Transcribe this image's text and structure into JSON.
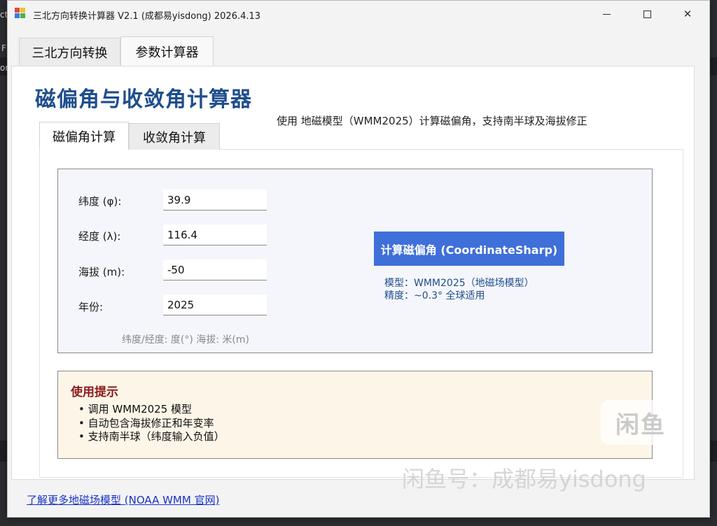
{
  "window": {
    "title": "三北方向转换计算器 V2.1 (成都易yisdong) 2026.4.13"
  },
  "outer_tabs": [
    {
      "label": "三北方向转换",
      "active": false
    },
    {
      "label": "参数计算器",
      "active": true
    }
  ],
  "page": {
    "title": "磁偏角与收敛角计算器",
    "subtitle": "使用 地磁模型（WMM2025）计算磁偏角，支持南半球及海拔修正"
  },
  "inner_tabs": [
    {
      "label": "磁偏角计算",
      "active": true
    },
    {
      "label": "收敛角计算",
      "active": false
    }
  ],
  "form": {
    "latitude": {
      "label": "纬度 (φ):",
      "value": "39.9"
    },
    "longitude": {
      "label": "经度 (λ):",
      "value": "116.4"
    },
    "altitude": {
      "label": "海拔 (m):",
      "value": "-50"
    },
    "year": {
      "label": "年份:",
      "value": "2025"
    },
    "unit_note": "纬度/经度: 度(°)  海拔: 米(m)"
  },
  "action": {
    "calc_label": "计算磁偏角 (CoordinateSharp)",
    "model_line": "模型：WMM2025（地磁场模型）",
    "accuracy_line": "精度：~0.3° 全球适用"
  },
  "tips": {
    "title": "使用提示",
    "items": [
      "• 调用 WMM2025 模型",
      "• 自动包含海拔修正和年变率",
      "• 支持南半球（纬度输入负值）"
    ]
  },
  "footer": {
    "link_label": "了解更多地磁场模型 (NOAA WMM 官网)"
  },
  "watermark": {
    "badge": "闲鱼",
    "text": "闲鱼号：成都易yisdong"
  },
  "background": {
    "left_fragments": [
      "ct",
      "F",
      "or"
    ]
  },
  "colors": {
    "accent_button": "#3f6fd8",
    "title_blue": "#1f4e8c",
    "tips_title": "#8b1a1a",
    "link": "#1a33c8"
  }
}
